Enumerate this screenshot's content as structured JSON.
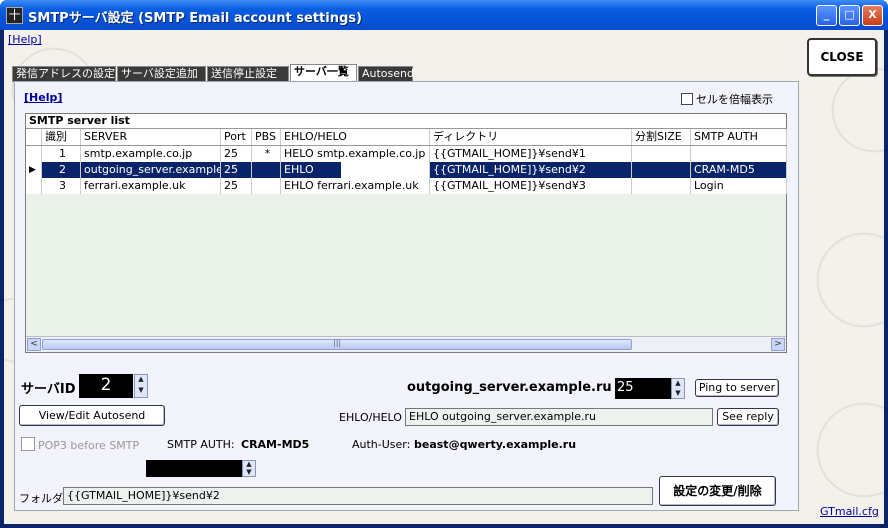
{
  "window": {
    "title": "SMTPサーバ設定 (SMTP Email account settings)",
    "minimize": "_",
    "maximize": "□",
    "close": "X",
    "app_icon": "十"
  },
  "help_top": "[Help]",
  "close_button": "CLOSE",
  "tabs": [
    "発信アドレスの設定",
    "サーバ設定追加",
    "送信停止設定",
    "サーバ一覧",
    "Autosend"
  ],
  "panel": {
    "help": "[Help]",
    "double_width_label": "セルを倍幅表示",
    "grid_caption": "SMTP server list",
    "columns": [
      "識別",
      "SERVER",
      "Port",
      "PBS",
      "EHLO/HELO",
      "ディレクトリ",
      "分割SIZE",
      "SMTP AUTH"
    ],
    "rows": [
      {
        "id": "1",
        "server": "smtp.example.co.jp",
        "port": "25",
        "pbs": "*",
        "ehlo": "HELO smtp.example.co.jp",
        "dir": "{{GTMAIL_HOME]}¥send¥1",
        "size": "",
        "auth": ""
      },
      {
        "id": "2",
        "server": "outgoing_server.exampler",
        "port": "25",
        "pbs": "",
        "ehlo": "EHLO",
        "dir": "{{GTMAIL_HOME]}¥send¥2",
        "size": "",
        "auth": "CRAM-MD5"
      },
      {
        "id": "3",
        "server": "ferrari.example.uk",
        "port": "25",
        "pbs": "",
        "ehlo": "EHLO ferrari.example.uk",
        "dir": "{{GTMAIL_HOME]}¥send¥3",
        "size": "",
        "auth": "Login"
      }
    ],
    "row_indicator": "▶",
    "scroll_left": "<",
    "scroll_right": ">",
    "scroll_grip": "|||"
  },
  "form": {
    "server_id_label": "サーバID",
    "server_id": "2",
    "view_edit_autosend": "View/Edit Autosend",
    "pop3_label": "POP3 before SMTP",
    "smtp_auth_label": "SMTP AUTH:",
    "smtp_auth_value": "CRAM-MD5",
    "auth_user_label": "Auth-User:",
    "auth_user_value": "beast@qwerty.example.ru",
    "server_name": "outgoing_server.example.ru",
    "port": "25",
    "ping_button": "Ping to server",
    "ehlo_label": "EHLO/HELO",
    "ehlo_value": "EHLO outgoing_server.example.ru",
    "see_reply": "See reply",
    "folder_label": "フォルダ",
    "folder_value": "{{GTMAIL_HOME]}¥send¥2",
    "apply_button": "設定の変更/削除",
    "gtmail_link": "GTmail.cfg",
    "spin_up": "▲",
    "spin_down": "▼"
  }
}
